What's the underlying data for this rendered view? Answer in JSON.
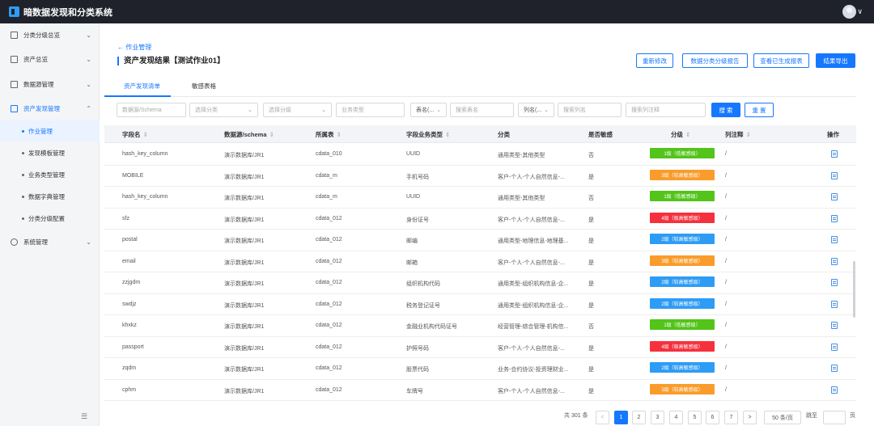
{
  "app": {
    "title": "暗数据发现和分类系统",
    "logo_icon": "app-logo-icon",
    "user_icon": "user-avatar-icon"
  },
  "sidebar": {
    "items": [
      {
        "label": "分类分级总览",
        "icon": "grid-icon",
        "expanded": false
      },
      {
        "label": "资产总览",
        "icon": "list-icon",
        "expanded": false
      },
      {
        "label": "数据源管理",
        "icon": "database-icon",
        "expanded": false
      },
      {
        "label": "资产发现管理",
        "icon": "discover-icon",
        "expanded": true
      },
      {
        "label": "系统管理",
        "icon": "settings-icon",
        "expanded": false
      }
    ],
    "sub_items": [
      {
        "label": "作业管理",
        "active": true
      },
      {
        "label": "发现模板管理",
        "active": false
      },
      {
        "label": "业务类型管理",
        "active": false
      },
      {
        "label": "数据字典管理",
        "active": false
      },
      {
        "label": "分类分级配置",
        "active": false
      }
    ],
    "collapse_icon": "menu-collapse-icon"
  },
  "page": {
    "back_label": "← 作业管理",
    "title": "资产发现结果【测试作业01】",
    "buttons": {
      "rerun": "重新修改",
      "report": "数据分类分级报告",
      "view_reports": "查看已生成报表",
      "export": "结果导出"
    },
    "tabs": [
      "资产发现清单",
      "敏感表格"
    ]
  },
  "filters": {
    "datasource_placeholder": "数据源/Schema",
    "category_placeholder": "选择分类",
    "level_placeholder": "选择分级",
    "biz_type_placeholder": "业务类型",
    "table_select": "表名(...",
    "table_placeholder": "搜索表名",
    "column_select": "列名(...",
    "column_placeholder": "搜索列名",
    "comment_placeholder": "搜索列注释",
    "search": "搜 索",
    "reset": "重 置"
  },
  "table": {
    "headers": [
      "字段名",
      "数据源/schema",
      "所属表",
      "字段业务类型",
      "分类",
      "是否敏感",
      "分级",
      "列注释",
      "操作"
    ],
    "rows": [
      {
        "field": "hash_key_column",
        "source": "演示数据库/JR1",
        "table": "cdata_010",
        "biz": "UUID",
        "cat": "通用类型-其他类型",
        "sensitive": "否",
        "level": "1级（低敏感级）",
        "level_color": "#52c41a",
        "comment": "/"
      },
      {
        "field": "MOBILE",
        "source": "演示数据库/JR1",
        "table": "cdata_m",
        "biz": "手机号码",
        "cat": "客户-个人-个人自然信息-...",
        "sensitive": "是",
        "level": "3级（较高敏感级）",
        "level_color": "#fa9c2b",
        "comment": "/"
      },
      {
        "field": "hash_key_column",
        "source": "演示数据库/JR1",
        "table": "cdata_m",
        "biz": "UUID",
        "cat": "通用类型-其他类型",
        "sensitive": "否",
        "level": "1级（低敏感级）",
        "level_color": "#52c41a",
        "comment": "/"
      },
      {
        "field": "sfz",
        "source": "演示数据库/JR1",
        "table": "cdata_012",
        "biz": "身份证号",
        "cat": "客户-个人-个人自然信息-...",
        "sensitive": "是",
        "level": "4级（极高敏感级）",
        "level_color": "#f5313e",
        "comment": "/"
      },
      {
        "field": "postal",
        "source": "演示数据库/JR1",
        "table": "cdata_012",
        "biz": "邮编",
        "cat": "通用类型-地理信息-地理基...",
        "sensitive": "是",
        "level": "2级（较高敏感级）",
        "level_color": "#2e9cf5",
        "comment": "/"
      },
      {
        "field": "email",
        "source": "演示数据库/JR1",
        "table": "cdata_012",
        "biz": "邮箱",
        "cat": "客户-个人-个人自然信息-...",
        "sensitive": "是",
        "level": "3级（较高敏感级）",
        "level_color": "#fa9c2b",
        "comment": "/"
      },
      {
        "field": "zzjgdm",
        "source": "演示数据库/JR1",
        "table": "cdata_012",
        "biz": "组织机构代码",
        "cat": "通用类型-组织机构信息-企...",
        "sensitive": "是",
        "level": "2级（较高敏感级）",
        "level_color": "#2e9cf5",
        "comment": "/"
      },
      {
        "field": "swdjz",
        "source": "演示数据库/JR1",
        "table": "cdata_012",
        "biz": "税务登记证号",
        "cat": "通用类型-组织机构信息-企...",
        "sensitive": "是",
        "level": "2级（较高敏感级）",
        "level_color": "#2e9cf5",
        "comment": "/"
      },
      {
        "field": "khxkz",
        "source": "演示数据库/JR1",
        "table": "cdata_012",
        "biz": "金融业机构代码证号",
        "cat": "经营管理-综合管理-机构信...",
        "sensitive": "否",
        "level": "1级（低敏感级）",
        "level_color": "#52c41a",
        "comment": "/"
      },
      {
        "field": "passport",
        "source": "演示数据库/JR1",
        "table": "cdata_012",
        "biz": "护照号码",
        "cat": "客户-个人-个人自然信息-...",
        "sensitive": "是",
        "level": "4级（极高敏感级）",
        "level_color": "#f5313e",
        "comment": "/"
      },
      {
        "field": "zqdm",
        "source": "演示数据库/JR1",
        "table": "cdata_012",
        "biz": "股票代码",
        "cat": "业务-合约协议-投资理财业...",
        "sensitive": "是",
        "level": "2级（较高敏感级）",
        "level_color": "#2e9cf5",
        "comment": "/"
      },
      {
        "field": "cphm",
        "source": "演示数据库/JR1",
        "table": "cdata_012",
        "biz": "车牌号",
        "cat": "客户-个人-个人自然信息-...",
        "sensitive": "是",
        "level": "3级（较高敏感级）",
        "level_color": "#fa9c2b",
        "comment": "/"
      }
    ]
  },
  "pagination": {
    "total": "共 301 条",
    "prev": "<",
    "pages": [
      "1",
      "2",
      "3",
      "4",
      "5",
      "6",
      "7"
    ],
    "current": "1",
    "next": ">",
    "page_size": "50 条/页",
    "goto": "跳至",
    "page_unit": "页"
  }
}
